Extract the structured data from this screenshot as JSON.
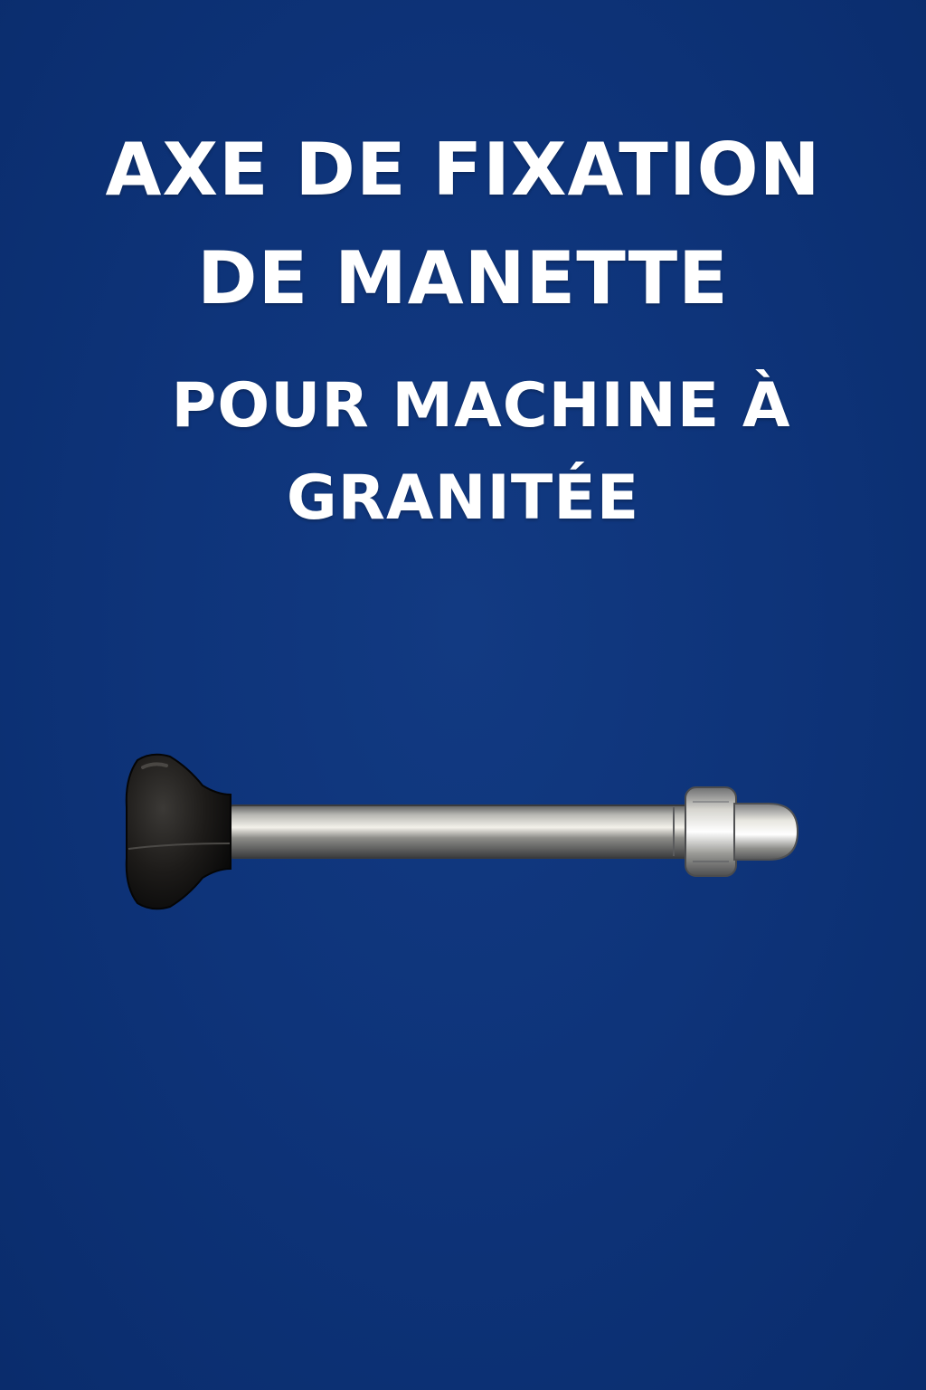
{
  "title": {
    "line1": "AXE DE FIXATION",
    "line2": "DE MANETTE",
    "line3": "POUR MACHINE À",
    "line4": "GRANITÉE"
  },
  "product": {
    "icon": "handle-fixing-pin-icon"
  },
  "colors": {
    "background": "#0e347a",
    "text": "#ffffff",
    "knob": "#1f1d1a",
    "metal": "#8e8e8c"
  }
}
